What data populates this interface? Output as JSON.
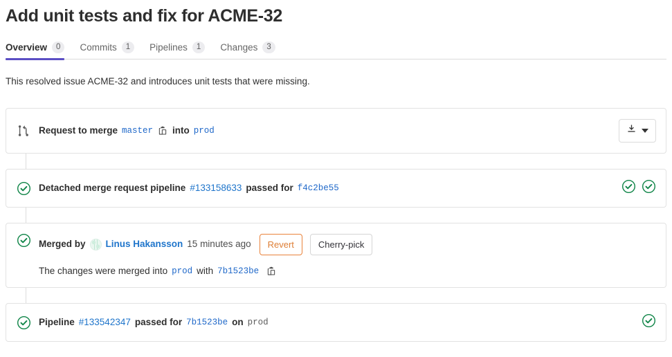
{
  "header": {
    "title": "Add unit tests and fix for ACME-32"
  },
  "tabs": [
    {
      "label": "Overview",
      "count": "0",
      "active": true,
      "name": "tab-overview"
    },
    {
      "label": "Commits",
      "count": "1",
      "active": false,
      "name": "tab-commits"
    },
    {
      "label": "Pipelines",
      "count": "1",
      "active": false,
      "name": "tab-pipelines"
    },
    {
      "label": "Changes",
      "count": "3",
      "active": false,
      "name": "tab-changes"
    }
  ],
  "description": "This resolved issue ACME-32 and introduces unit tests that were missing.",
  "merge_widget": {
    "icon": "merge-request-icon",
    "prefix": "Request to merge",
    "source_branch": "master",
    "copy_icon": "copy-icon",
    "into": "into",
    "target_branch": "prod",
    "download_icon": "download-icon",
    "download_caret_icon": "chevron-down-icon"
  },
  "pipeline_detached": {
    "status_icon": "status-success-icon",
    "prefix": "Detached merge request pipeline",
    "pipeline_id": "#133158633",
    "middle": "passed for",
    "commit_sha": "f4c2be55",
    "badge_icons": [
      "status-success-icon",
      "status-success-icon"
    ]
  },
  "merged_widget": {
    "status_icon": "status-success-icon",
    "prefix": "Merged by",
    "avatar": "user-avatar",
    "author": "Linus Hakansson",
    "timestamp": "15 minutes ago",
    "revert_label": "Revert",
    "cherry_pick_label": "Cherry-pick",
    "detail_prefix": "The changes were merged into",
    "detail_branch": "prod",
    "detail_with": "with",
    "detail_sha": "7b1523be",
    "detail_copy_icon": "copy-icon"
  },
  "pipeline_final": {
    "status_icon": "status-success-icon",
    "prefix": "Pipeline",
    "pipeline_id": "#133542347",
    "middle": "passed for",
    "commit_sha": "7b1523be",
    "on": "on",
    "branch": "prod",
    "badge_icon": "status-success-icon"
  },
  "colors": {
    "accent": "#5b4ec4",
    "link": "#1f75cb",
    "success": "#108548",
    "warning": "#e9823a",
    "border": "#e2e2e2"
  }
}
